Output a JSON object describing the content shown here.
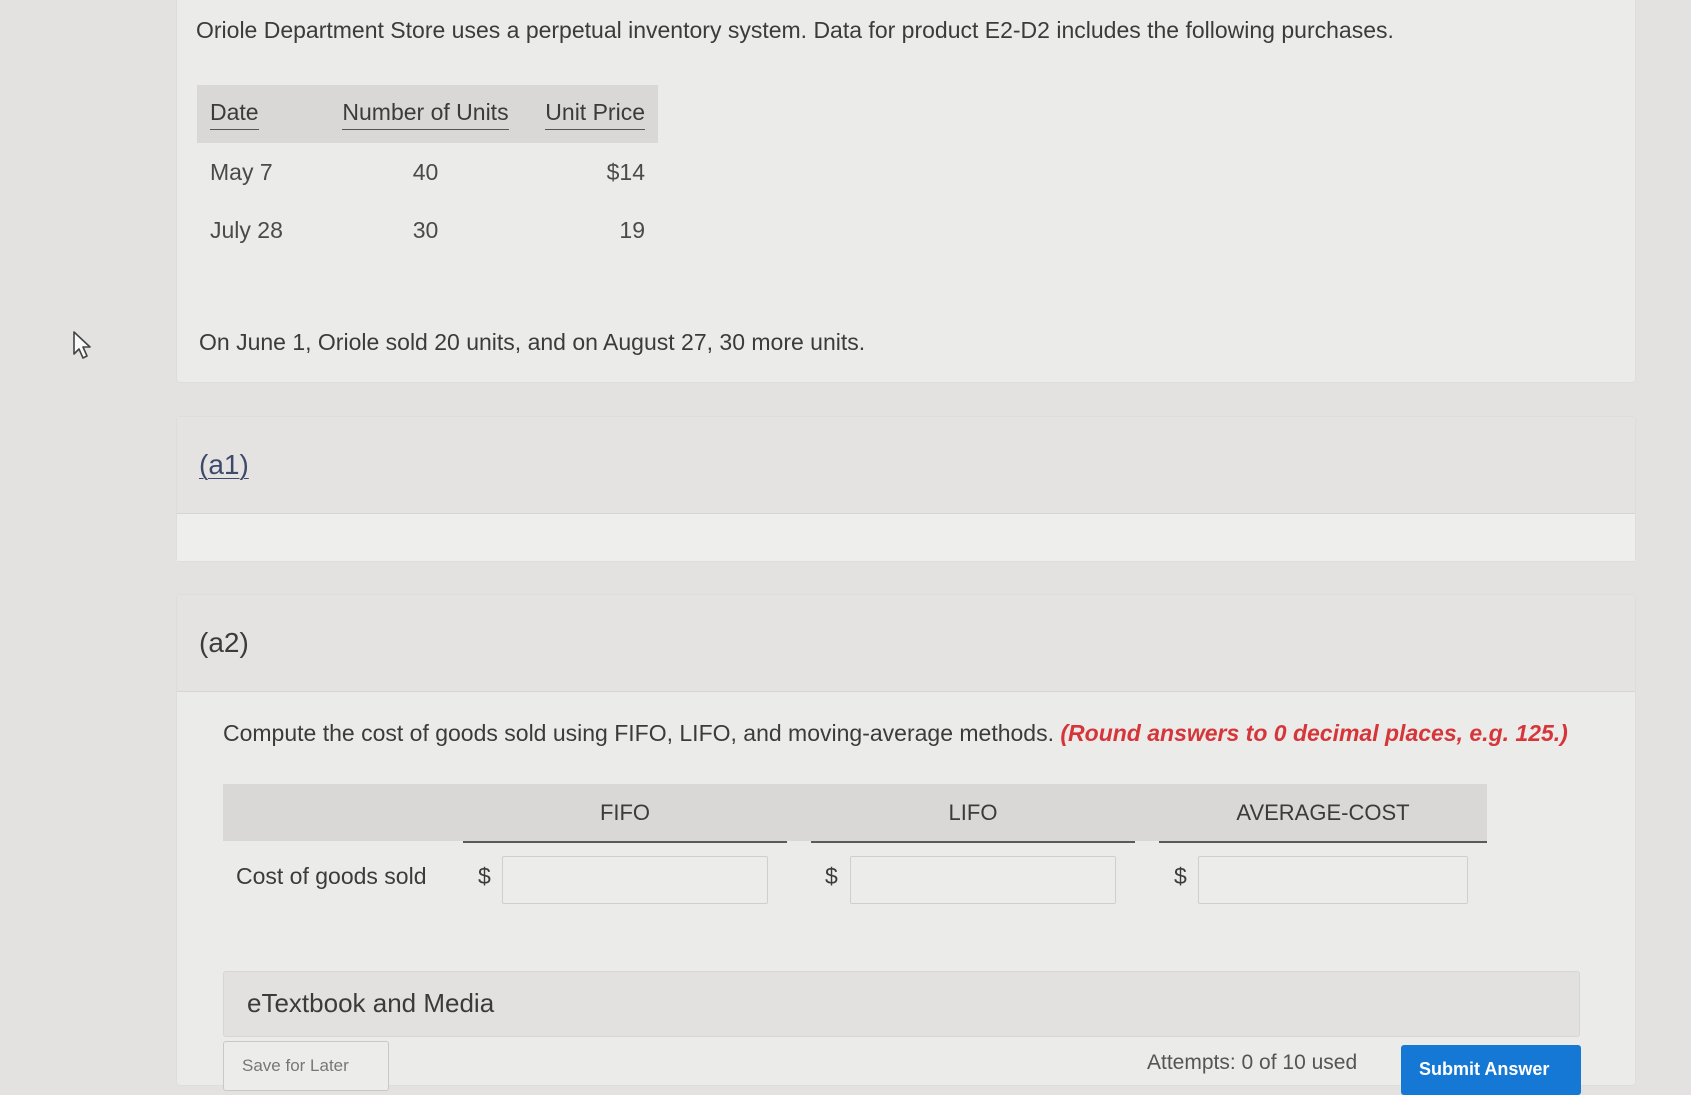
{
  "problem": {
    "intro": "Oriole Department Store uses a perpetual inventory system. Data for product E2-D2 includes the following purchases.",
    "table": {
      "headers": [
        "Date",
        "Number of Units",
        "Unit Price"
      ],
      "rows": [
        {
          "date": "May 7",
          "units": "40",
          "price": "$14"
        },
        {
          "date": "July 28",
          "units": "30",
          "price": "19"
        }
      ]
    },
    "sales": "On June 1, Oriole sold 20 units, and on August 27, 30 more units."
  },
  "section_a1": {
    "label": "(a1)"
  },
  "section_a2": {
    "label": "(a2)",
    "question": "Compute the cost of goods sold using FIFO, LIFO, and moving-average methods.",
    "round_note": "(Round answers to 0 decimal places, e.g. 125.)",
    "columns": [
      "FIFO",
      "LIFO",
      "AVERAGE-COST"
    ],
    "row_label": "Cost of goods sold",
    "currency": "$",
    "answers": {
      "fifo": "",
      "lifo": "",
      "average": ""
    }
  },
  "etextbook": {
    "label": "eTextbook and Media"
  },
  "footer": {
    "save_label": "Save for Later",
    "attempts": "Attempts: 0 of 10 used",
    "submit_label": "Submit Answer"
  },
  "colors": {
    "accent": "#1578d4",
    "round_note": "#d6363a",
    "link": "#3d4a6a"
  },
  "icons": [
    "mouse-pointer-icon"
  ]
}
